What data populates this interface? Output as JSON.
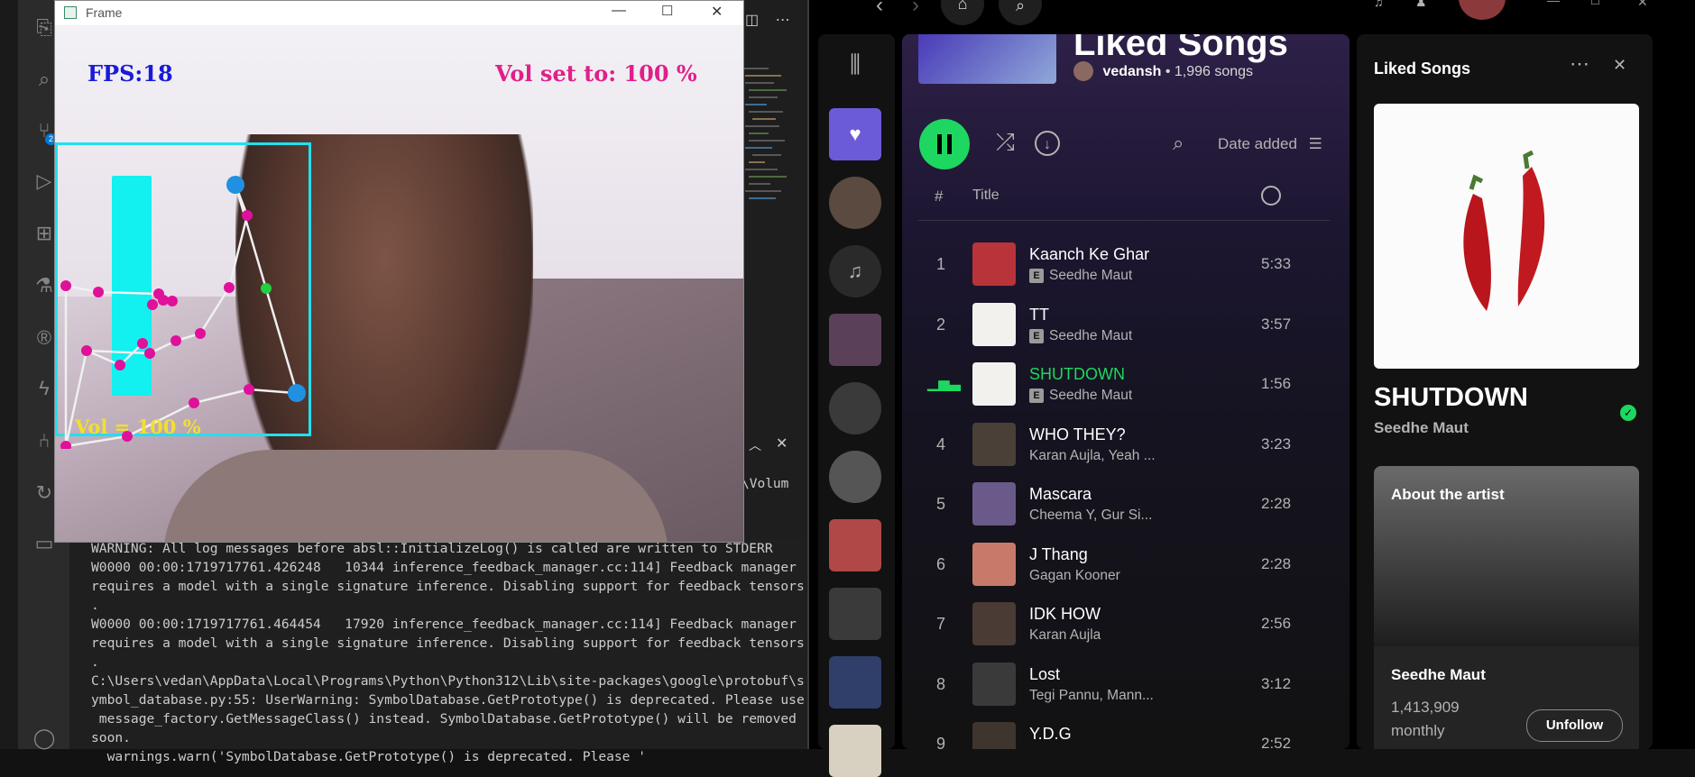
{
  "frame_window": {
    "title": "Frame",
    "fps_text": "FPS:18",
    "vol_set_text": "Vol set to: 100 %",
    "vol_bar_text": "Vol = 100 %",
    "volume_level_pct": 100
  },
  "vscode": {
    "panel_tab_partial": "\\Volum",
    "terminal_lines": [
      "WARNING: All log messages before absl::InitializeLog() is called are written to STDERR",
      "W0000 00:00:1719717761.426248   10344 inference_feedback_manager.cc:114] Feedback manager",
      "requires a model with a single signature inference. Disabling support for feedback tensors",
      ".",
      "W0000 00:00:1719717761.464454   17920 inference_feedback_manager.cc:114] Feedback manager",
      "requires a model with a single signature inference. Disabling support for feedback tensors",
      ".",
      "C:\\Users\\vedan\\AppData\\Local\\Programs\\Python\\Python312\\Lib\\site-packages\\google\\protobuf\\s",
      "ymbol_database.py:55: UserWarning: SymbolDatabase.GetPrototype() is deprecated. Please use",
      " message_factory.GetMessageClass() instead. SymbolDatabase.GetPrototype() will be removed",
      "soon.",
      "  warnings.warn('SymbolDatabase.GetPrototype() is deprecated. Please '"
    ],
    "activity_icons": [
      "explorer-icon",
      "search-icon",
      "source-control-icon",
      "run-debug-icon",
      "extensions-icon",
      "testing-icon",
      "remote-icon",
      "lightning-icon",
      "git-graph-icon",
      "settings-sync-icon",
      "chat-icon",
      "account-icon"
    ],
    "source_control_badge": "2"
  },
  "spotify": {
    "playlist": {
      "title": "Liked Songs",
      "owner": "vedansh",
      "song_count": "• 1,996 songs"
    },
    "sort_label": "Date added",
    "list_header": {
      "number": "#",
      "title": "Title"
    },
    "tracks": [
      {
        "num": "1",
        "title": "Kaanch Ke Ghar",
        "artist": "Seedhe Maut",
        "explicit": true,
        "duration": "5:33",
        "art_color": "#b8333a"
      },
      {
        "num": "2",
        "title": "TT",
        "artist": "Seedhe Maut",
        "explicit": true,
        "duration": "3:57",
        "art_color": "#f3f1ee"
      },
      {
        "num": "",
        "title": "SHUTDOWN",
        "artist": "Seedhe Maut",
        "explicit": true,
        "duration": "1:56",
        "art_color": "#f3f1ee",
        "playing": true
      },
      {
        "num": "4",
        "title": "WHO THEY?",
        "artist": "Karan Aujla, Yeah ...",
        "explicit": false,
        "duration": "3:23",
        "art_color": "#4a4038"
      },
      {
        "num": "5",
        "title": "Mascara",
        "artist": "Cheema Y, Gur Si...",
        "explicit": false,
        "duration": "2:28",
        "art_color": "#6a5a8a"
      },
      {
        "num": "6",
        "title": "J Thang",
        "artist": "Gagan Kooner",
        "explicit": false,
        "duration": "2:28",
        "art_color": "#c87a6a"
      },
      {
        "num": "7",
        "title": "IDK HOW",
        "artist": "Karan Aujla",
        "explicit": false,
        "duration": "2:56",
        "art_color": "#4a3b35"
      },
      {
        "num": "8",
        "title": "Lost",
        "artist": "Tegi Pannu, Mann...",
        "explicit": false,
        "duration": "3:12",
        "art_color": "#3a3a3a"
      },
      {
        "num": "9",
        "title": "Y.D.G",
        "artist": "",
        "explicit": false,
        "duration": "2:52",
        "art_color": "#3e352e"
      }
    ],
    "now_playing": {
      "panel_title": "Liked Songs",
      "track": "SHUTDOWN",
      "artist": "Seedhe Maut",
      "about_label": "About the artist",
      "artist_name": "Seedhe Maut",
      "listeners_count": "1,413,909",
      "listeners_unit": "monthly",
      "unfollow_label": "Unfollow"
    },
    "library_tiles": [
      "#6b5bd9",
      "#5a4a40",
      "#2a2a2a",
      "#5a4058",
      "#3a3a3a",
      "#555555",
      "#b04848",
      "#3a3a3a",
      "#2f3f6a",
      "#d8d0c0"
    ],
    "accent_green": "#1ed760"
  }
}
